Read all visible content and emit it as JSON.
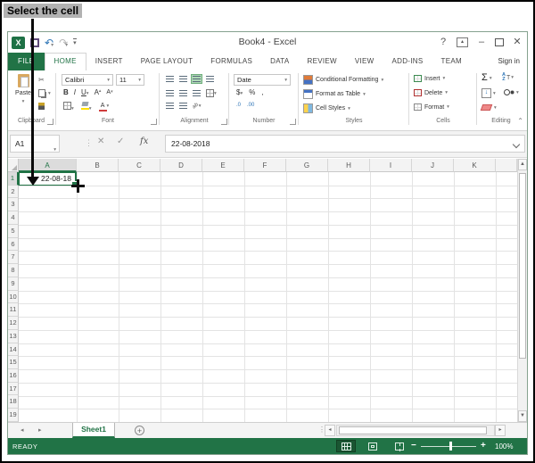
{
  "colors": {
    "excel_green": "#217346",
    "selection_border": "#217346",
    "callout_highlight": "#b2b2b2",
    "active_align_bg": "#aed9b6"
  },
  "callout": {
    "label": "Select the cell"
  },
  "titlebar": {
    "title": "Book4 - Excel",
    "help": "?",
    "minimize": "–",
    "close": "✕"
  },
  "ribbon_tabs": {
    "file": "FILE",
    "items": [
      "HOME",
      "INSERT",
      "PAGE LAYOUT",
      "FORMULAS",
      "DATA",
      "REVIEW",
      "VIEW",
      "ADD-INS",
      "TEAM"
    ],
    "active": "HOME",
    "sign_in": "Sign in"
  },
  "ribbon": {
    "clipboard": {
      "label": "Clipboard",
      "paste": "Paste"
    },
    "font": {
      "label": "Font",
      "name": "Calibri",
      "size": "11",
      "bold": "B",
      "italic": "I",
      "underline": "U",
      "grow_font": "A",
      "shrink_font": "A"
    },
    "alignment": {
      "label": "Alignment"
    },
    "number": {
      "label": "Number",
      "format": "Date",
      "currency": "$",
      "percent": "%",
      "comma": ",",
      "inc_decimal": ".0",
      "dec_decimal": ".00"
    },
    "styles": {
      "label": "Styles",
      "conditional": "Conditional Formatting",
      "format_table": "Format as Table",
      "cell_styles": "Cell Styles"
    },
    "cells": {
      "label": "Cells",
      "insert": "Insert",
      "delete": "Delete",
      "format": "Format"
    },
    "editing": {
      "label": "Editing",
      "autosum": "Σ",
      "sort_a": "A",
      "sort_z": "Z",
      "funnel": "T",
      "fill_arrow": "↓"
    }
  },
  "formula_bar": {
    "name_box": "A1",
    "cancel": "✕",
    "enter": "✓",
    "fx": "fx",
    "value": "22-08-2018"
  },
  "grid": {
    "columns": [
      "A",
      "B",
      "C",
      "D",
      "E",
      "F",
      "G",
      "H",
      "I",
      "J",
      "K"
    ],
    "row_count": 19,
    "selected_column": "A",
    "selected_row": "1",
    "active_cell": {
      "ref": "A1",
      "value": "22-08-18"
    }
  },
  "sheet_bar": {
    "active_sheet": "Sheet1"
  },
  "status_bar": {
    "mode": "READY",
    "zoom_level": "100%"
  },
  "icons": {
    "dropdown": "▾",
    "undo": "↶",
    "redo": "↷",
    "scissors": "✂",
    "nav_left": "◂",
    "nav_right": "▸",
    "scroll_up": "▲",
    "scroll_down": "▼",
    "collapse_ribbon": "⌃",
    "new_sheet": "+"
  }
}
